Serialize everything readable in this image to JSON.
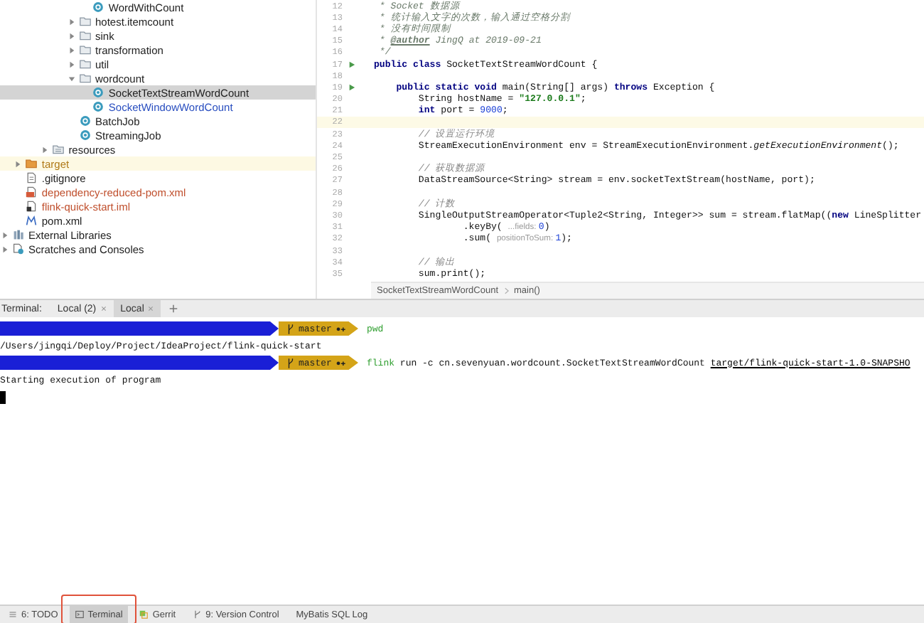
{
  "project_tree": {
    "items": [
      {
        "children": [
          {
            "children": [
              {
                "children": [
                  {
                    "children": [
                      {
                        "children": [
                          {
                            "children": [
                              {
                                "label": "WordWithCount",
                                "kind": "class",
                                "color": "#222222",
                                "selected": false
                              }
                            ]
                          },
                          {
                            "label": "hotest.itemcount",
                            "kind": "folder",
                            "color": "#222222",
                            "expanded": false,
                            "selected": false
                          },
                          {
                            "label": "sink",
                            "kind": "folder",
                            "color": "#222222",
                            "expanded": false,
                            "selected": false
                          },
                          {
                            "label": "transformation",
                            "kind": "folder",
                            "color": "#222222",
                            "expanded": false,
                            "selected": false
                          },
                          {
                            "label": "util",
                            "kind": "folder",
                            "color": "#222222",
                            "expanded": false,
                            "selected": false
                          },
                          {
                            "label": "wordcount",
                            "kind": "folder",
                            "color": "#222222",
                            "expanded": true,
                            "selected": false,
                            "children": [
                              {
                                "label": "SocketTextStreamWordCount",
                                "kind": "class",
                                "color": "#222222",
                                "selected": true
                              },
                              {
                                "label": "SocketWindowWordCount",
                                "kind": "class",
                                "color": "#2a4fc0",
                                "selected": false
                              }
                            ]
                          },
                          {
                            "label": "BatchJob",
                            "kind": "class",
                            "color": "#222222",
                            "selected": false
                          },
                          {
                            "label": "StreamingJob",
                            "kind": "class",
                            "color": "#222222",
                            "selected": false
                          }
                        ]
                      }
                    ]
                  },
                  {
                    "label": "resources",
                    "kind": "resources-folder",
                    "color": "#222222",
                    "expanded": false,
                    "selected": false
                  }
                ]
              }
            ]
          },
          {
            "label": "target",
            "kind": "excluded-folder",
            "color": "#b07a18",
            "expanded": false,
            "selected": false
          },
          {
            "label": ".gitignore",
            "kind": "text-file",
            "color": "#222222",
            "selected": false
          },
          {
            "label": "dependency-reduced-pom.xml",
            "kind": "xml-file",
            "color": "#c0502e",
            "selected": false
          },
          {
            "label": "flink-quick-start.iml",
            "kind": "module-file",
            "color": "#c0502e",
            "selected": false
          },
          {
            "label": "pom.xml",
            "kind": "maven-file",
            "color": "#222222",
            "selected": false
          }
        ]
      },
      {
        "label": "External Libraries",
        "kind": "libraries",
        "color": "#222222",
        "expanded": false,
        "selected": false
      },
      {
        "label": "Scratches and Consoles",
        "kind": "scratches",
        "color": "#222222",
        "expanded": false,
        "selected": false
      }
    ]
  },
  "editor": {
    "lines": [
      {
        "number": "12",
        "runnable": false,
        "current": false,
        "segments": [
          {
            "kind": "doc",
            "text": " * Socket 数据源"
          }
        ]
      },
      {
        "number": "13",
        "runnable": false,
        "current": false,
        "segments": [
          {
            "kind": "doc",
            "text": " * 统计输入文字的次数，输入通过空格分割"
          }
        ]
      },
      {
        "number": "14",
        "runnable": false,
        "current": false,
        "segments": [
          {
            "kind": "doc",
            "text": " * 没有时间限制"
          }
        ]
      },
      {
        "number": "15",
        "runnable": false,
        "current": false,
        "segments": [
          {
            "kind": "doc",
            "text": " * "
          },
          {
            "kind": "doctag",
            "text": "@author"
          },
          {
            "kind": "doc",
            "text": " JingQ at 2019-09-21"
          }
        ]
      },
      {
        "number": "16",
        "runnable": false,
        "current": false,
        "segments": [
          {
            "kind": "doc",
            "text": " */"
          }
        ]
      },
      {
        "number": "17",
        "runnable": true,
        "current": false,
        "segments": [
          {
            "kind": "keyword",
            "text": "public class "
          },
          {
            "kind": "plain",
            "text": "SocketTextStreamWordCount {"
          }
        ]
      },
      {
        "number": "18",
        "runnable": false,
        "current": false
      },
      {
        "number": "19",
        "runnable": true,
        "current": false,
        "segments": [
          {
            "kind": "keyword",
            "text": "    public static void "
          },
          {
            "kind": "plain",
            "text": "main(String[] args) "
          },
          {
            "kind": "keyword",
            "text": "throws "
          },
          {
            "kind": "plain",
            "text": "Exception {"
          }
        ]
      },
      {
        "number": "20",
        "runnable": false,
        "current": false,
        "segments": [
          {
            "kind": "plain",
            "text": "        String hostName = "
          },
          {
            "kind": "string",
            "text": "\"127.0.0.1\""
          },
          {
            "kind": "plain",
            "text": ";"
          }
        ]
      },
      {
        "number": "21",
        "runnable": false,
        "current": false,
        "segments": [
          {
            "kind": "keyword",
            "text": "        int "
          },
          {
            "kind": "plain",
            "text": "port = "
          },
          {
            "kind": "number",
            "text": "9000"
          },
          {
            "kind": "plain",
            "text": ";"
          }
        ]
      },
      {
        "number": "22",
        "runnable": false,
        "current": true
      },
      {
        "number": "23",
        "runnable": false,
        "current": false,
        "segments": [
          {
            "kind": "comment",
            "text": "        // 设置运行环境"
          }
        ]
      },
      {
        "number": "24",
        "runnable": false,
        "current": false,
        "segments": [
          {
            "kind": "plain",
            "text": "        StreamExecutionEnvironment env = StreamExecutionEnvironment."
          },
          {
            "kind": "italic",
            "text": "getExecutionEnvironment"
          },
          {
            "kind": "plain",
            "text": "();"
          }
        ]
      },
      {
        "number": "25",
        "runnable": false,
        "current": false
      },
      {
        "number": "26",
        "runnable": false,
        "current": false,
        "segments": [
          {
            "kind": "comment",
            "text": "        // 获取数据源"
          }
        ]
      },
      {
        "number": "27",
        "runnable": false,
        "current": false,
        "segments": [
          {
            "kind": "plain",
            "text": "        DataStreamSource<String> stream = env.socketTextStream(hostName, port);"
          }
        ]
      },
      {
        "number": "28",
        "runnable": false,
        "current": false
      },
      {
        "number": "29",
        "runnable": false,
        "current": false,
        "segments": [
          {
            "kind": "comment",
            "text": "        // 计数"
          }
        ]
      },
      {
        "number": "30",
        "runnable": false,
        "current": false,
        "segments": [
          {
            "kind": "plain",
            "text": "        SingleOutputStreamOperator<Tuple2<String, Integer>> sum = stream.flatMap(("
          },
          {
            "kind": "keyword",
            "text": "new "
          },
          {
            "kind": "plain",
            "text": "LineSplitter"
          }
        ]
      },
      {
        "number": "31",
        "runnable": false,
        "current": false,
        "segments": [
          {
            "kind": "plain",
            "text": "                .keyBy( "
          },
          {
            "kind": "hint",
            "text": "...fields: "
          },
          {
            "kind": "number",
            "text": "0"
          },
          {
            "kind": "plain",
            "text": ")"
          }
        ]
      },
      {
        "number": "32",
        "runnable": false,
        "current": false,
        "segments": [
          {
            "kind": "plain",
            "text": "                .sum( "
          },
          {
            "kind": "hint",
            "text": "positionToSum: "
          },
          {
            "kind": "number",
            "text": "1"
          },
          {
            "kind": "plain",
            "text": ");"
          }
        ]
      },
      {
        "number": "33",
        "runnable": false,
        "current": false
      },
      {
        "number": "34",
        "runnable": false,
        "current": false,
        "segments": [
          {
            "kind": "comment",
            "text": "        // 输出"
          }
        ]
      },
      {
        "number": "35",
        "runnable": false,
        "current": false,
        "segments": [
          {
            "kind": "plain",
            "text": "        sum.print();"
          }
        ]
      }
    ],
    "breadcrumbs": [
      "SocketTextStreamWordCount",
      "main()"
    ]
  },
  "terminal": {
    "title": "Terminal:",
    "tabs": [
      {
        "label": "Local (2)",
        "selected": false
      },
      {
        "label": "Local",
        "selected": true
      }
    ],
    "lines": [
      {
        "kind": "prompt",
        "branch": "master",
        "status": "●✚",
        "command": [
          {
            "kind": "command",
            "text": "pwd"
          }
        ]
      },
      {
        "kind": "output",
        "text": "/Users/jingqi/Deploy/Project/IdeaProject/flink-quick-start"
      },
      {
        "kind": "prompt",
        "branch": "master",
        "status": "●✚",
        "command": [
          {
            "kind": "command",
            "text": "flink"
          },
          {
            "kind": "plain",
            "text": " run -c cn.sevenyuan.wordcount.SocketTextStreamWordCount "
          },
          {
            "kind": "path",
            "text": "target/flink-quick-start-1.0-SNAPSHO"
          }
        ]
      },
      {
        "kind": "output",
        "text": "Starting execution of program"
      },
      {
        "kind": "cursor"
      }
    ]
  },
  "tool_window_bar": [
    {
      "label": "6: TODO",
      "kind": "todo",
      "selected": false,
      "annotated": false
    },
    {
      "label": "Terminal",
      "kind": "terminal",
      "selected": true,
      "annotated": true
    },
    {
      "label": "Gerrit",
      "kind": "gerrit",
      "selected": false,
      "annotated": false
    },
    {
      "label": "9: Version Control",
      "kind": "vcs",
      "selected": false,
      "annotated": false
    },
    {
      "label": "MyBatis SQL Log",
      "kind": "plain",
      "selected": false,
      "annotated": false
    }
  ]
}
